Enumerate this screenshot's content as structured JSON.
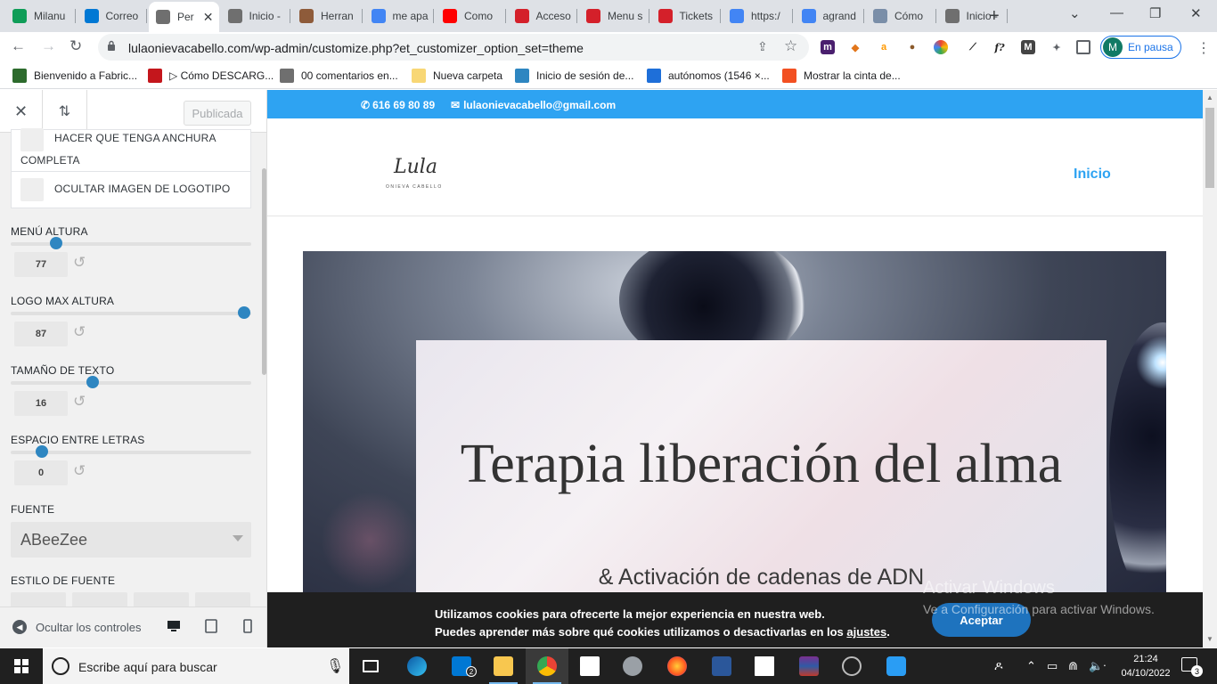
{
  "browser": {
    "tabs": [
      {
        "title": "Milanu",
        "icon": "sheets-icon",
        "color": "#0f9d58"
      },
      {
        "title": "Correo",
        "icon": "outlook-icon",
        "color": "#0078d4"
      },
      {
        "title": "Per",
        "icon": "wordpress-icon",
        "color": "#6f6f6f",
        "active": true
      },
      {
        "title": "Inicio -",
        "icon": "wordpress-icon",
        "color": "#6f6f6f"
      },
      {
        "title": "Herran",
        "icon": "people-icon",
        "color": "#8e5b3a"
      },
      {
        "title": "me apa",
        "icon": "google-icon",
        "color": "#4285f4"
      },
      {
        "title": "Como",
        "icon": "youtube-icon",
        "color": "#ff0000"
      },
      {
        "title": "Acceso",
        "icon": "wix-icon",
        "color": "#d4202a"
      },
      {
        "title": "Menu s",
        "icon": "wix-circle-icon",
        "color": "#d4202a"
      },
      {
        "title": "Tickets",
        "icon": "wix-icon",
        "color": "#d4202a"
      },
      {
        "title": "https:/",
        "icon": "google-icon",
        "color": "#4285f4"
      },
      {
        "title": "agrand",
        "icon": "google-icon",
        "color": "#4285f4"
      },
      {
        "title": "Cómo",
        "icon": "edge-icon",
        "color": "#7a8ea8"
      },
      {
        "title": "Inicio -",
        "icon": "wordpress-icon",
        "color": "#6f6f6f"
      }
    ],
    "url": "lulaonievacabello.com/wp-admin/customize.php?et_customizer_option_set=theme",
    "profile_initial": "M",
    "profile_status": "En pausa",
    "bookmarks": [
      {
        "label": "Bienvenido a Fabric...",
        "icon": "fabric-icon",
        "color": "#2d6b2d"
      },
      {
        "label": "▷ Cómo DESCARG...",
        "icon": "m-icon",
        "color": "#c4161c"
      },
      {
        "label": "00 comentarios en...",
        "icon": "wordpress-icon",
        "color": "#6f6f6f"
      },
      {
        "label": "Nueva carpeta",
        "icon": "folder-icon",
        "color": "#f8d775"
      },
      {
        "label": "Inicio de sesión de...",
        "icon": "sr-icon",
        "color": "#2e86c1"
      },
      {
        "label": "autónomos (1546 ×...",
        "icon": "circle-c-icon",
        "color": "#1e6fd9"
      },
      {
        "label": "Mostrar la cinta de...",
        "icon": "microsoft-icon",
        "color": "#f25022"
      }
    ]
  },
  "customizer": {
    "publish_label": "Publicada",
    "opt_full_width": "HACER QUE TENGA ANCHURA",
    "opt_full_width_2": "COMPLETA",
    "opt_hide_logo": "OCULTAR IMAGEN DE LOGOTIPO",
    "menu_height": {
      "label": "MENÚ ALTURA",
      "value": "77",
      "fraction": 0.19
    },
    "logo_max_height": {
      "label": "LOGO MAX ALTURA",
      "value": "87",
      "fraction": 0.97
    },
    "text_size": {
      "label": "TAMAÑO DE TEXTO",
      "value": "16",
      "fraction": 0.34
    },
    "letter_spacing": {
      "label": "ESPACIO ENTRE LETRAS",
      "value": "0",
      "fraction": 0.13
    },
    "font_label": "FUENTE",
    "font_value": "ABeeZee",
    "font_style_label": "ESTILO DE FUENTE",
    "hide_controls": "Ocultar los controles"
  },
  "site": {
    "phone": "616 69 80 89",
    "email": "lulaonievacabello@gmail.com",
    "logo_text": "Lula",
    "logo_sub": "ONIEVA CABELLO",
    "nav_home": "Inicio",
    "hero_title": "Terapia liberación del alma",
    "hero_subtitle": "& Activación de cadenas de ADN",
    "cookie_line1": "Utilizamos cookies para ofrecerte la mejor experiencia en nuestra web.",
    "cookie_line2a": "Puedes aprender más sobre qué cookies utilizamos o desactivarlas en los ",
    "cookie_link": "ajustes",
    "cookie_line2b": ".",
    "accept": "Aceptar",
    "accent": "#2ea3f2"
  },
  "windows": {
    "activate_title": "Activar Windows",
    "activate_sub": "Ve a Configuración para activar Windows.",
    "search_placeholder": "Escribe aquí para buscar",
    "time": "21:24",
    "date": "04/10/2022",
    "mail_badge": "2",
    "notif_count": "3"
  }
}
